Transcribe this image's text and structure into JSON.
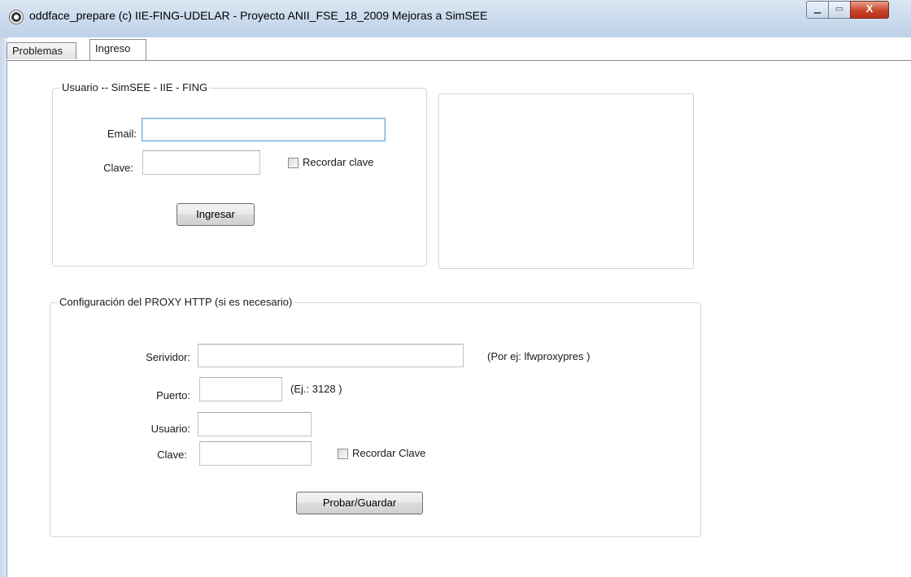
{
  "window": {
    "title": "oddface_prepare (c) IIE-FING-UDELAR - Proyecto ANII_FSE_18_2009 Mejoras a SimSEE",
    "minimize_glyph": "▁",
    "maximize_glyph": "▭",
    "close_glyph": "X"
  },
  "tabs": [
    {
      "label": "Problemas",
      "active": false
    },
    {
      "label": "Ingreso",
      "active": true
    }
  ],
  "user_group": {
    "legend": "Usuario -- SimSEE - IIE - FING",
    "email_label": "Email:",
    "email_value": "",
    "password_label": "Clave:",
    "password_value": "",
    "remember_label": "Recordar clave",
    "remember_checked": false,
    "login_button": "Ingresar"
  },
  "proxy_group": {
    "legend": "Configuración del PROXY HTTP (si es necesario)",
    "server_label": "Serividor:",
    "server_value": "",
    "server_hint": "(Por ej: lfwproxypres )",
    "port_label": "Puerto:",
    "port_value": "",
    "port_hint": "(Ej.: 3128 )",
    "user_label": "Usuario:",
    "user_value": "",
    "password_label": "Clave:",
    "password_value": "",
    "remember_label": "Recordar Clave",
    "remember_checked": false,
    "test_save_button": "Probar/Guardar"
  }
}
